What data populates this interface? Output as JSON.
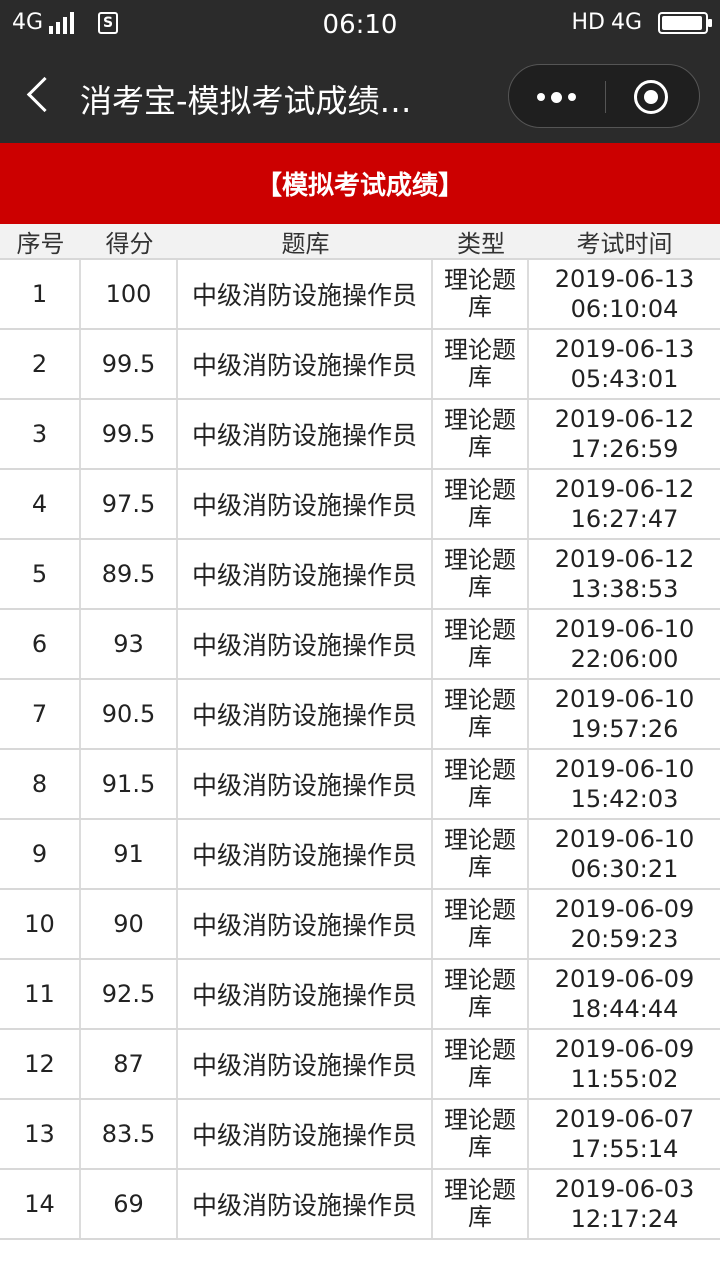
{
  "status_bar": {
    "network": "4G",
    "time": "06:10",
    "hd_label": "HD",
    "network_right": "4G",
    "battery_level": 0.95
  },
  "nav": {
    "title": "消考宝-模拟考试成绩…",
    "icons": [
      "back-icon",
      "more-icon",
      "close-icon"
    ]
  },
  "header": {
    "title": "【模拟考试成绩】",
    "background": "#cc0000"
  },
  "table": {
    "columns": [
      "序号",
      "得分",
      "题库",
      "类型",
      "考试时间"
    ],
    "rows": [
      {
        "no": "1",
        "score": "100",
        "bank": "中级消防设施操作员",
        "type": "理论题库",
        "date": "2019-06-13",
        "time": "06:10:04"
      },
      {
        "no": "2",
        "score": "99.5",
        "bank": "中级消防设施操作员",
        "type": "理论题库",
        "date": "2019-06-13",
        "time": "05:43:01"
      },
      {
        "no": "3",
        "score": "99.5",
        "bank": "中级消防设施操作员",
        "type": "理论题库",
        "date": "2019-06-12",
        "time": "17:26:59"
      },
      {
        "no": "4",
        "score": "97.5",
        "bank": "中级消防设施操作员",
        "type": "理论题库",
        "date": "2019-06-12",
        "time": "16:27:47"
      },
      {
        "no": "5",
        "score": "89.5",
        "bank": "中级消防设施操作员",
        "type": "理论题库",
        "date": "2019-06-12",
        "time": "13:38:53"
      },
      {
        "no": "6",
        "score": "93",
        "bank": "中级消防设施操作员",
        "type": "理论题库",
        "date": "2019-06-10",
        "time": "22:06:00"
      },
      {
        "no": "7",
        "score": "90.5",
        "bank": "中级消防设施操作员",
        "type": "理论题库",
        "date": "2019-06-10",
        "time": "19:57:26"
      },
      {
        "no": "8",
        "score": "91.5",
        "bank": "中级消防设施操作员",
        "type": "理论题库",
        "date": "2019-06-10",
        "time": "15:42:03"
      },
      {
        "no": "9",
        "score": "91",
        "bank": "中级消防设施操作员",
        "type": "理论题库",
        "date": "2019-06-10",
        "time": "06:30:21"
      },
      {
        "no": "10",
        "score": "90",
        "bank": "中级消防设施操作员",
        "type": "理论题库",
        "date": "2019-06-09",
        "time": "20:59:23"
      },
      {
        "no": "11",
        "score": "92.5",
        "bank": "中级消防设施操作员",
        "type": "理论题库",
        "date": "2019-06-09",
        "time": "18:44:44"
      },
      {
        "no": "12",
        "score": "87",
        "bank": "中级消防设施操作员",
        "type": "理论题库",
        "date": "2019-06-09",
        "time": "11:55:02"
      },
      {
        "no": "13",
        "score": "83.5",
        "bank": "中级消防设施操作员",
        "type": "理论题库",
        "date": "2019-06-07",
        "time": "17:55:14"
      },
      {
        "no": "14",
        "score": "69",
        "bank": "中级消防设施操作员",
        "type": "理论题库",
        "date": "2019-06-03",
        "time": "12:17:24"
      }
    ]
  }
}
